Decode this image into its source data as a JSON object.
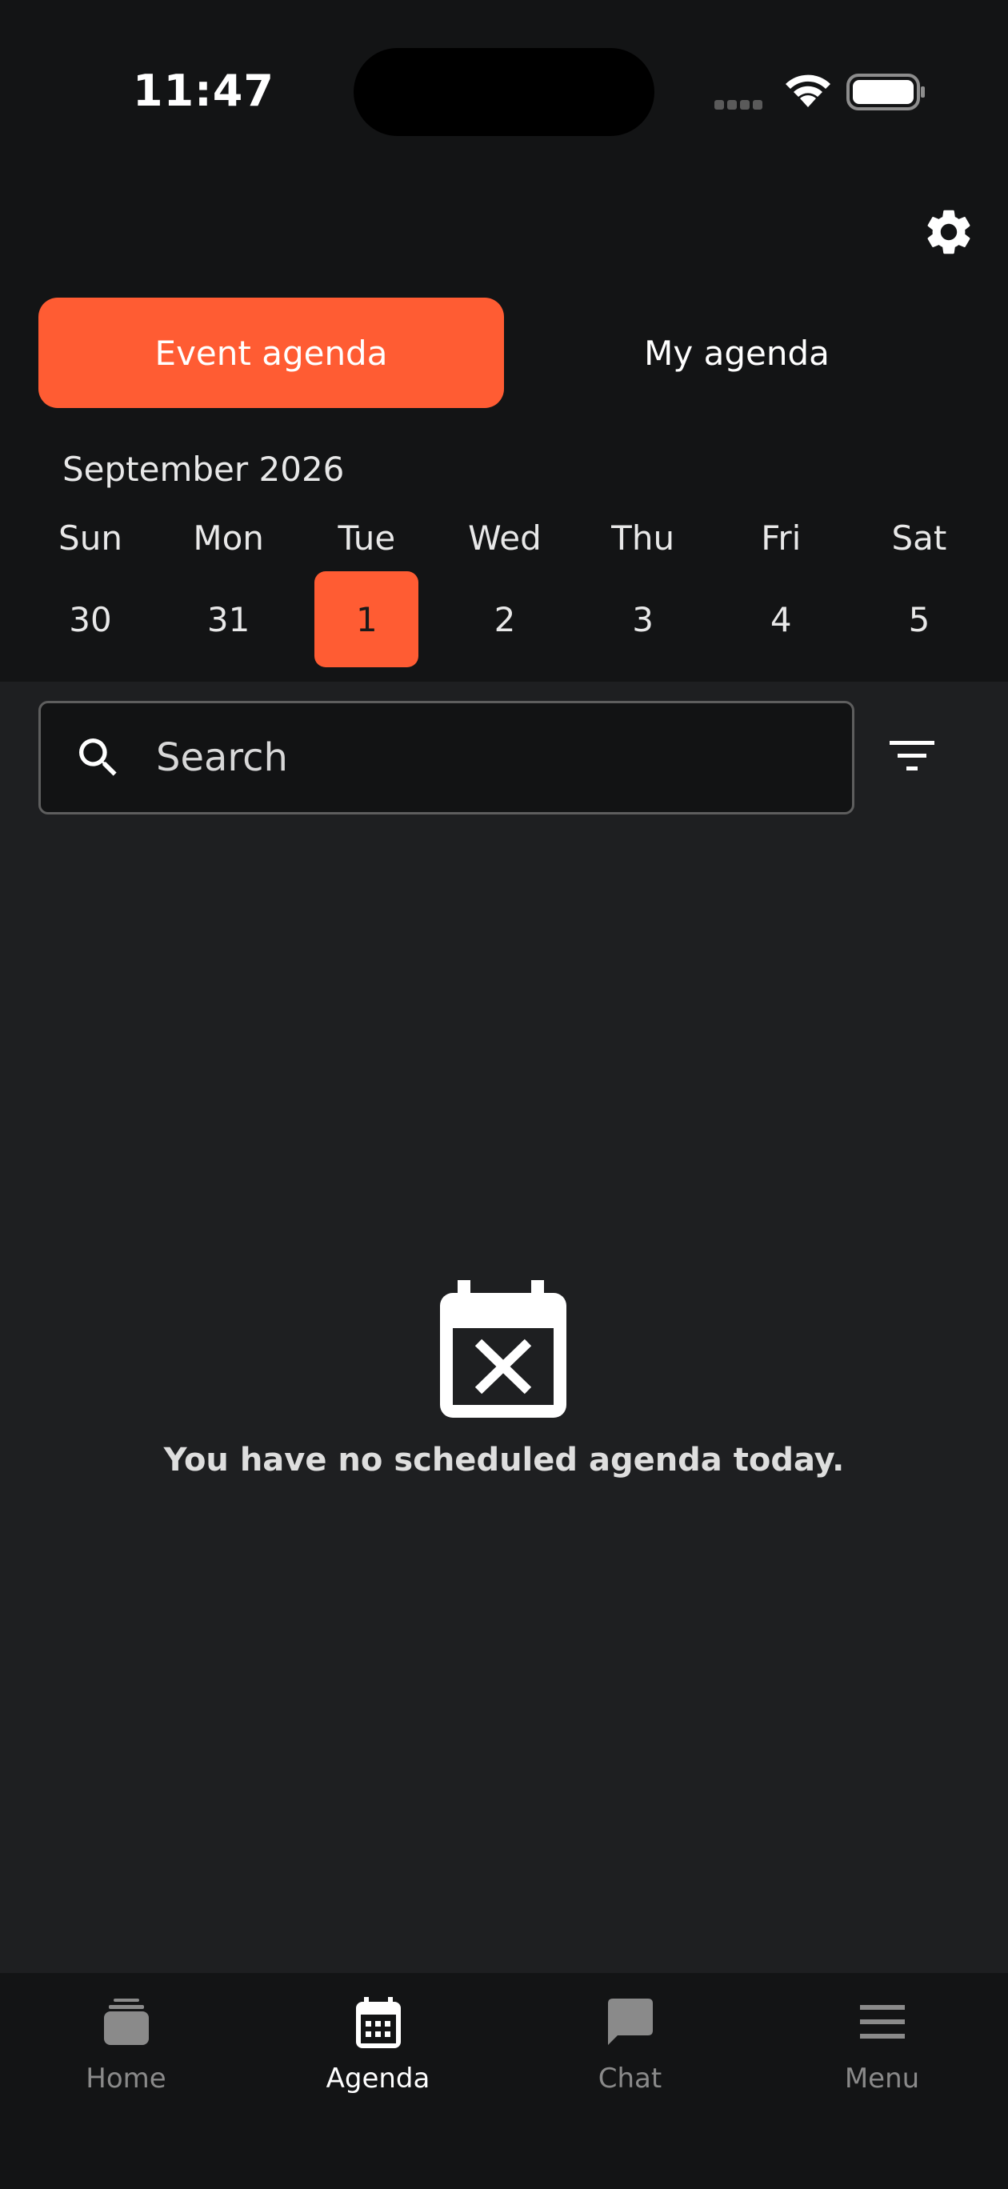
{
  "status_bar": {
    "time": "11:47"
  },
  "segments": {
    "event_agenda": "Event agenda",
    "my_agenda": "My agenda"
  },
  "calendar": {
    "month": "September 2026",
    "weekdays": [
      "Sun",
      "Mon",
      "Tue",
      "Wed",
      "Thu",
      "Fri",
      "Sat"
    ],
    "dates": [
      "30",
      "31",
      "1",
      "2",
      "3",
      "4",
      "5"
    ],
    "selected_index": 2
  },
  "search": {
    "placeholder": "Search",
    "value": ""
  },
  "empty_state": {
    "message": "You have no scheduled agenda today.",
    "icon": "calendar-x-icon"
  },
  "tabbar": {
    "items": [
      {
        "label": "Home",
        "icon": "home-icon"
      },
      {
        "label": "Agenda",
        "icon": "calendar-icon"
      },
      {
        "label": "Chat",
        "icon": "chat-icon"
      },
      {
        "label": "Menu",
        "icon": "menu-icon"
      }
    ],
    "active_index": 1
  },
  "colors": {
    "accent": "#ff5c33",
    "background": "#1e1f21",
    "header": "#131415"
  }
}
